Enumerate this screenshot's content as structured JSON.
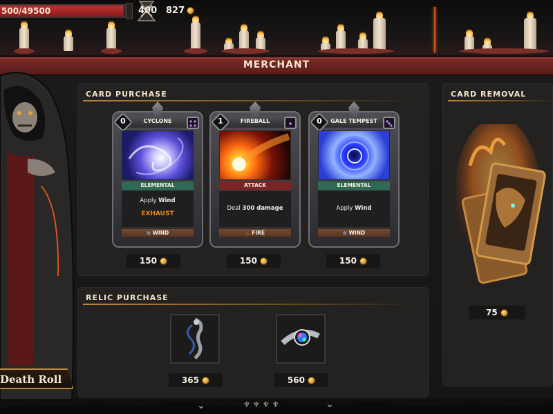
{
  "status_bar": {
    "hp_text": "500/49500",
    "hp_fraction": 0.995,
    "level": "400",
    "gold": "827"
  },
  "banner": {
    "title": "MERCHANT"
  },
  "card_purchase": {
    "title": "CARD PURCHASE",
    "cards": [
      {
        "name": "CYCLONE",
        "cost": "0",
        "type": "ELEMENTAL",
        "desc_pre": "Apply ",
        "desc_bold": "Wind",
        "keyword": "EXHAUST",
        "element": "WIND",
        "price": "150",
        "type_color": "#2e6a54",
        "art": "cyclone"
      },
      {
        "name": "FIREBALL",
        "cost": "1",
        "type": "ATTACK",
        "desc_pre": "Deal ",
        "desc_bold": "300 damage",
        "keyword": "",
        "element": "FIRE",
        "price": "150",
        "type_color": "#7a2424",
        "art": "fireball"
      },
      {
        "name": "GALE TEMPEST",
        "cost": "0",
        "type": "ELEMENTAL",
        "desc_pre": "Apply ",
        "desc_bold": "Wind",
        "keyword": "",
        "element": "WIND",
        "price": "150",
        "type_color": "#2e6a54",
        "art": "gale"
      }
    ]
  },
  "relic_purchase": {
    "title": "RELIC PURCHASE",
    "relics": [
      {
        "price": "365",
        "icon": "dragon-staff-icon"
      },
      {
        "price": "560",
        "icon": "gem-bracelet-icon"
      }
    ]
  },
  "card_removal": {
    "title": "CARD REMOVAL",
    "price": "75"
  },
  "skill_label": "Death Roll",
  "colors": {
    "banner": "#6b2322",
    "accent_gold": "#b98a3a",
    "exhaust": "#e88a1c"
  }
}
